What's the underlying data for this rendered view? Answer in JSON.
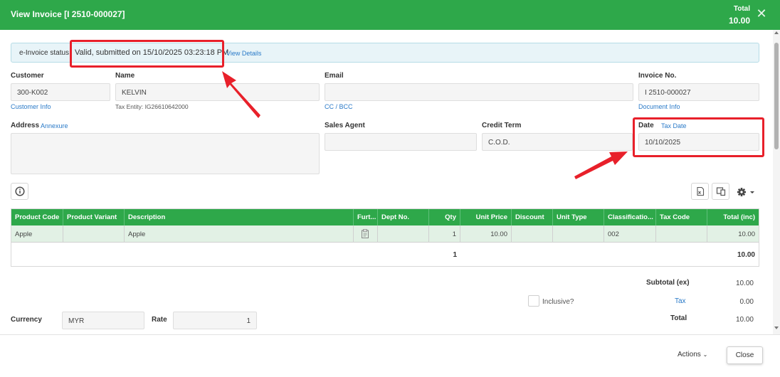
{
  "header": {
    "title": "View Invoice [I 2510-000027]",
    "total_label": "Total",
    "total_value": "10.00",
    "close_icon": "close-icon"
  },
  "einvoice": {
    "label": "e-Invoice status",
    "status_text": "Valid, submitted on 15/10/2025 03:23:18 PM",
    "link": "View Details"
  },
  "customer": {
    "label": "Customer",
    "value": "300-K002",
    "link": "Customer Info"
  },
  "name": {
    "label": "Name",
    "value": "KELVIN",
    "tax_entity": "Tax Entity: IG26610642000"
  },
  "email": {
    "label": "Email",
    "value": "",
    "link": "CC / BCC"
  },
  "invoice_no": {
    "label": "Invoice No.",
    "value": "I 2510-000027",
    "link": "Document Info"
  },
  "address": {
    "label": "Address",
    "link": "Annexure",
    "value": ""
  },
  "sales_agent": {
    "label": "Sales Agent",
    "value": ""
  },
  "credit_term": {
    "label": "Credit Term",
    "value": "C.O.D."
  },
  "date": {
    "label": "Date",
    "link": "Tax Date",
    "value": "10/10/2025"
  },
  "toolbar": {
    "info_icon": "info-icon",
    "export_icon": "spreadsheet-export-icon",
    "copy_icon": "copy-device-icon",
    "gear_icon": "gear-icon",
    "accent": "#2ea84a",
    "annotation_color": "#e8202a"
  },
  "table": {
    "columns": [
      "Product Code",
      "Product Variant",
      "Description",
      "Furt...",
      "Dept No.",
      "Qty",
      "Unit Price",
      "Discount",
      "Unit Type",
      "Classificatio...",
      "Tax Code",
      "Total (inc)"
    ],
    "rows": [
      {
        "product_code": "Apple",
        "product_variant": "",
        "description": "Apple",
        "further_icon": "clipboard-icon",
        "dept_no": "",
        "qty": "1",
        "unit_price": "10.00",
        "discount": "",
        "unit_type": "",
        "classification": "002",
        "tax_code": "",
        "total": "10.00"
      }
    ],
    "totals": {
      "qty": "1",
      "total": "10.00"
    }
  },
  "summary": {
    "subtotal_label": "Subtotal (ex)",
    "subtotal_value": "10.00",
    "inclusive_label": "Inclusive?",
    "tax_label": "Tax",
    "tax_value": "0.00",
    "total_label": "Total",
    "total_value": "10.00"
  },
  "currency": {
    "label": "Currency",
    "value": "MYR",
    "rate_label": "Rate",
    "rate_value": "1"
  },
  "footer": {
    "actions_label": "Actions",
    "close_label": "Close"
  }
}
